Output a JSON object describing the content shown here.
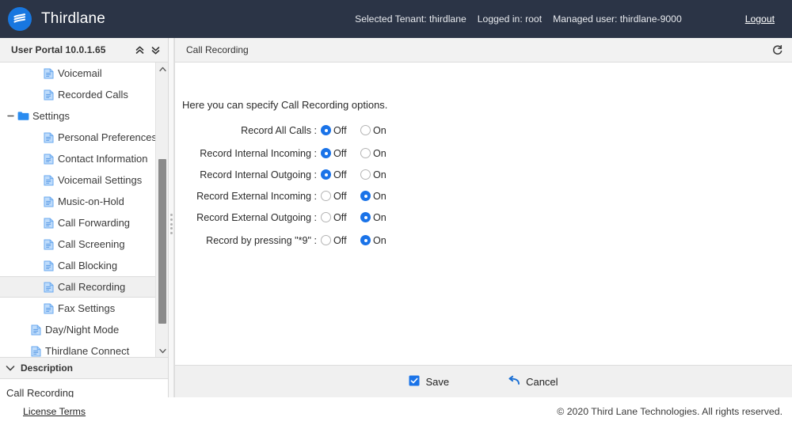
{
  "header": {
    "brand_name": "Thirdlane",
    "logo_icon": "thirdlane-waves-icon",
    "selected_tenant": "Selected Tenant: thirdlane",
    "logged_in": "Logged in: root",
    "managed_user": "Managed user: thirdlane-9000",
    "logout_label": "Logout",
    "background_color": "#2b3446",
    "accent_color": "#1877e0"
  },
  "sidebar": {
    "title": "User Portal 10.0.1.65",
    "collapse_all_icon": "double-chevron-up-icon",
    "expand_all_icon": "double-chevron-down-icon",
    "scroll_up_icon": "chevron-up-icon",
    "scroll_down_icon": "chevron-down-icon",
    "tree": [
      {
        "label": "Voicemail",
        "level": 2,
        "icon": "document-icon",
        "selected": false,
        "expander": ""
      },
      {
        "label": "Recorded Calls",
        "level": 2,
        "icon": "document-icon",
        "selected": false,
        "expander": ""
      },
      {
        "label": "Settings",
        "level": 0,
        "icon": "folder-icon",
        "selected": false,
        "expander": "minus"
      },
      {
        "label": "Personal Preferences",
        "level": 2,
        "icon": "document-icon",
        "selected": false,
        "expander": ""
      },
      {
        "label": "Contact Information",
        "level": 2,
        "icon": "document-icon",
        "selected": false,
        "expander": ""
      },
      {
        "label": "Voicemail Settings",
        "level": 2,
        "icon": "document-icon",
        "selected": false,
        "expander": ""
      },
      {
        "label": "Music-on-Hold",
        "level": 2,
        "icon": "document-icon",
        "selected": false,
        "expander": ""
      },
      {
        "label": "Call Forwarding",
        "level": 2,
        "icon": "document-icon",
        "selected": false,
        "expander": ""
      },
      {
        "label": "Call Screening",
        "level": 2,
        "icon": "document-icon",
        "selected": false,
        "expander": ""
      },
      {
        "label": "Call Blocking",
        "level": 2,
        "icon": "document-icon",
        "selected": false,
        "expander": ""
      },
      {
        "label": "Call Recording",
        "level": 2,
        "icon": "document-icon",
        "selected": true,
        "expander": ""
      },
      {
        "label": "Fax Settings",
        "level": 2,
        "icon": "document-icon",
        "selected": false,
        "expander": ""
      },
      {
        "label": "Day/Night Mode",
        "level": 1,
        "icon": "document-icon",
        "selected": false,
        "expander": ""
      },
      {
        "label": "Thirdlane Connect",
        "level": 1,
        "icon": "document-icon",
        "selected": false,
        "expander": ""
      }
    ],
    "description": {
      "header_label": "Description",
      "toggle_icon": "chevron-down-icon",
      "text": "Call Recording"
    }
  },
  "main": {
    "panel_title": "Call Recording",
    "refresh_icon": "refresh-icon",
    "intro_text": "Here you can specify Call Recording options.",
    "options": [
      {
        "label": "Record All Calls :",
        "off_label": "Off",
        "on_label": "On",
        "value": "Off",
        "spaced": false
      },
      {
        "label": "Record Internal Incoming :",
        "off_label": "Off",
        "on_label": "On",
        "value": "Off",
        "spaced": true
      },
      {
        "label": "Record Internal Outgoing :",
        "off_label": "Off",
        "on_label": "On",
        "value": "Off",
        "spaced": false
      },
      {
        "label": "Record External Incoming :",
        "off_label": "Off",
        "on_label": "On",
        "value": "On",
        "spaced": false
      },
      {
        "label": "Record External Outgoing :",
        "off_label": "Off",
        "on_label": "On",
        "value": "On",
        "spaced": false
      },
      {
        "label": "Record by pressing \"*9\" :",
        "off_label": "Off",
        "on_label": "On",
        "value": "On",
        "spaced": true
      }
    ],
    "save_label": "Save",
    "save_icon": "save-checkbox-icon",
    "cancel_label": "Cancel",
    "cancel_icon": "undo-arrow-icon"
  },
  "footer": {
    "license_label": "License Terms",
    "copyright": "© 2020 Third Lane Technologies. All rights reserved."
  }
}
